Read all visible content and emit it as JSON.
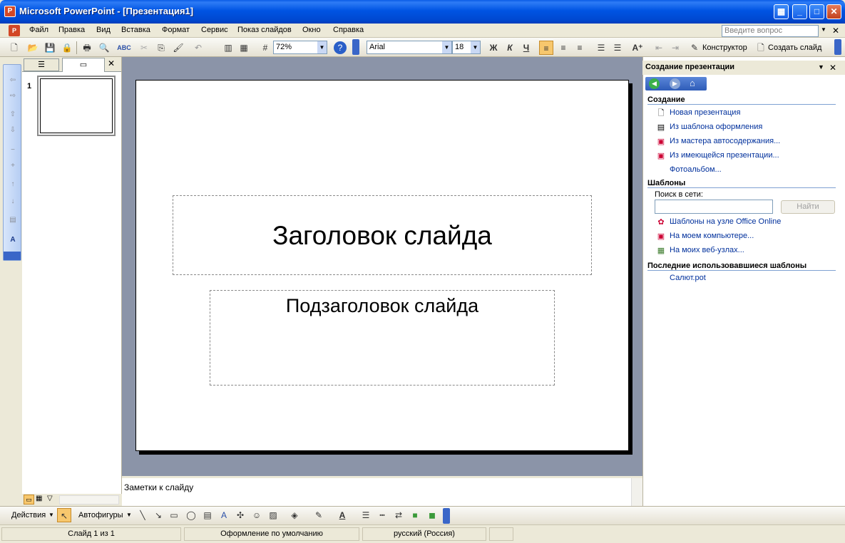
{
  "window": {
    "title": "Microsoft PowerPoint - [Презентация1]"
  },
  "menu": {
    "items": [
      "Файл",
      "Правка",
      "Вид",
      "Вставка",
      "Формат",
      "Сервис",
      "Показ слайдов",
      "Окно",
      "Справка"
    ],
    "ask_placeholder": "Введите вопрос"
  },
  "toolbar": {
    "zoom": "72%",
    "font": "Arial",
    "font_size": "18",
    "bold": "Ж",
    "italic": "К",
    "underline": "Ч",
    "designer_label": "Конструктор",
    "new_slide_label": "Создать слайд"
  },
  "slides_pane": {
    "slide_number": "1"
  },
  "slide": {
    "title": "Заголовок слайда",
    "subtitle": "Подзаголовок слайда"
  },
  "notes": {
    "placeholder": "Заметки к слайду"
  },
  "taskpane": {
    "title": "Создание презентации",
    "create_section": "Создание",
    "create_links": [
      "Новая презентация",
      "Из шаблона оформления",
      "Из мастера автосодержания...",
      "Из имеющейся презентации...",
      "Фотоальбом..."
    ],
    "templates_section": "Шаблоны",
    "search_label": "Поиск в сети:",
    "search_button": "Найти",
    "template_links": [
      "Шаблоны на узле Office Online",
      "На моем компьютере...",
      "На моих веб-узлах..."
    ],
    "recent_section": "Последние использовавшиеся шаблоны",
    "recent_items": [
      "Салют.pot"
    ]
  },
  "drawbar": {
    "actions_label": "Действия",
    "autoshapes_label": "Автофигуры"
  },
  "status": {
    "slide": "Слайд 1 из 1",
    "design": "Оформление по умолчанию",
    "language": "русский (Россия)"
  },
  "colors": {
    "titlebar": "#0054e3",
    "workarea": "#8b94a8",
    "link": "#00309c"
  }
}
